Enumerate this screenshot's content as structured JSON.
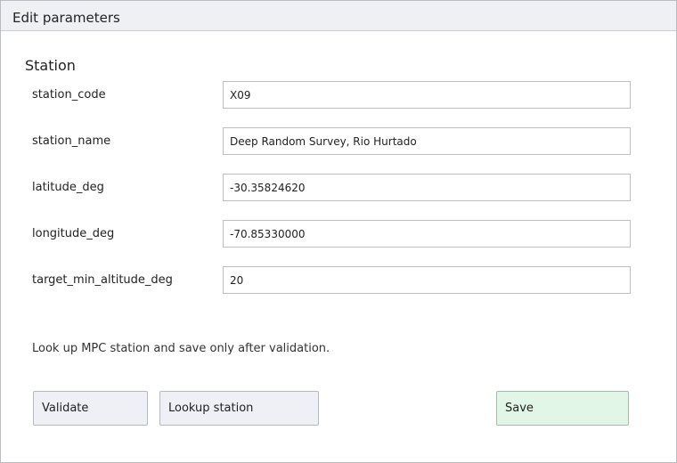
{
  "window": {
    "title": "Edit parameters"
  },
  "section": {
    "title": "Station"
  },
  "fields": [
    {
      "label": "station_code",
      "value": "X09"
    },
    {
      "label": "station_name",
      "value": "Deep Random Survey, Rio Hurtado"
    },
    {
      "label": "latitude_deg",
      "value": "-30.35824620"
    },
    {
      "label": "longitude_deg",
      "value": "-70.85330000"
    },
    {
      "label": "target_min_altitude_deg",
      "value": "20"
    }
  ],
  "note": "Look up MPC station and save only after validation.",
  "buttons": {
    "validate": "Validate",
    "lookup": "Lookup station",
    "save": "Save"
  },
  "colors": {
    "titlebar_bg": "#eef0f4",
    "button_bg": "#eef0f5",
    "save_bg": "#e1f6e6"
  }
}
